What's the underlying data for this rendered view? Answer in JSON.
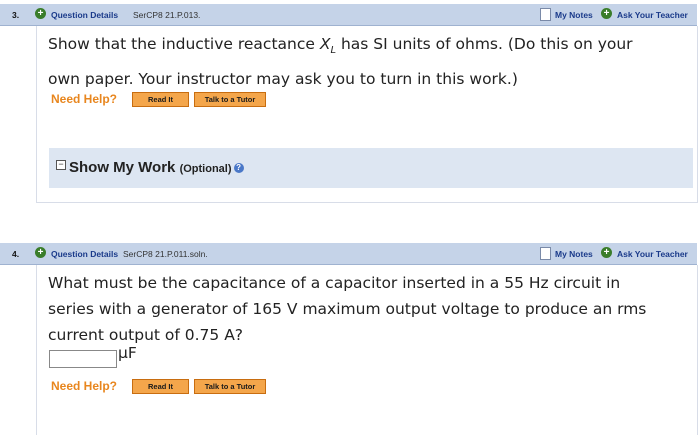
{
  "q3": {
    "number": "3.",
    "details_label": "Question Details",
    "code": "SerCP8 21.P.013.",
    "my_notes": "My Notes",
    "ask_teacher": "Ask Your Teacher",
    "text_line1_pre": "Show that the inductive reactance ",
    "symbol": "X",
    "subscript": "L",
    "text_line1_post": " has SI units of ohms. (Do this on your",
    "text_line2": "own paper. Your instructor may ask you to turn in this work.)",
    "need_help": "Need Help?",
    "read_it": "Read It",
    "talk_tutor": "Talk to a Tutor",
    "show_my_work": "Show My Work",
    "optional": "(Optional)"
  },
  "q4": {
    "number": "4.",
    "details_label": "Question Details",
    "code": "SerCP8 21.P.011.soln.",
    "my_notes": "My Notes",
    "ask_teacher": "Ask Your Teacher",
    "text_line1": "What must be the capacitance of a capacitor inserted in a 55 Hz circuit in",
    "text_line2": "series with a generator of 165 V maximum output voltage to produce an rms",
    "text_line3": "current output of 0.75 A?",
    "answer_value": "",
    "unit": "μF",
    "need_help": "Need Help?",
    "read_it": "Read It",
    "talk_tutor": "Talk to a Tutor"
  },
  "icons": {
    "plus": "+",
    "toggle": "−",
    "help": "?"
  }
}
